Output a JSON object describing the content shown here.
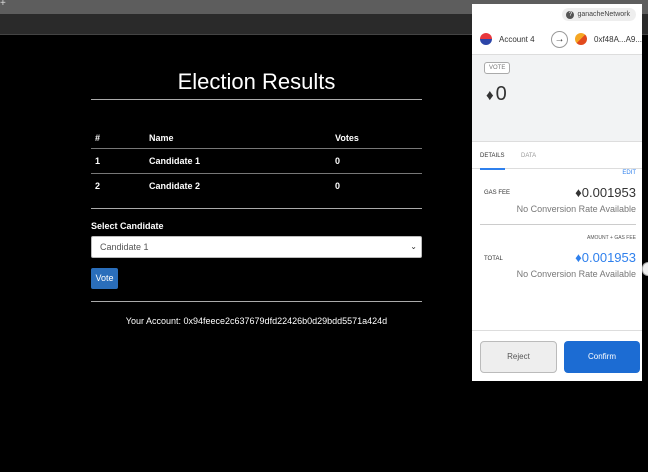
{
  "dapp": {
    "title": "Election Results",
    "table": {
      "headers": [
        "#",
        "Name",
        "Votes"
      ],
      "rows": [
        [
          "1",
          "Candidate 1",
          "0"
        ],
        [
          "2",
          "Candidate 2",
          "0"
        ]
      ]
    },
    "select_label": "Select Candidate",
    "select_value": "Candidate 1",
    "vote_label": "Vote",
    "account_text": "Your Account: 0x94feece2c637679dfd22426b0d29bdd5571a424d"
  },
  "metamask": {
    "network": "ganacheNetwork",
    "account_name": "Account 4",
    "recipient": "0xf48A...A9...",
    "type_badge": "VOTE",
    "amount": "0",
    "tabs": [
      "DETAILS",
      "DATA"
    ],
    "edit_label": "EDIT",
    "gas_fee_label": "GAS FEE",
    "gas_fee_value": "0.001953",
    "no_conversion": "No Conversion Rate Available",
    "amount_plus_gas": "AMOUNT + GAS FEE",
    "total_label": "TOTAL",
    "total_value": "0.001953",
    "reject_label": "Reject",
    "confirm_label": "Confirm"
  },
  "colors": {
    "accent": "#2f80ed",
    "confirm": "#1c6cd3",
    "vote_button": "#2a6ebb"
  }
}
